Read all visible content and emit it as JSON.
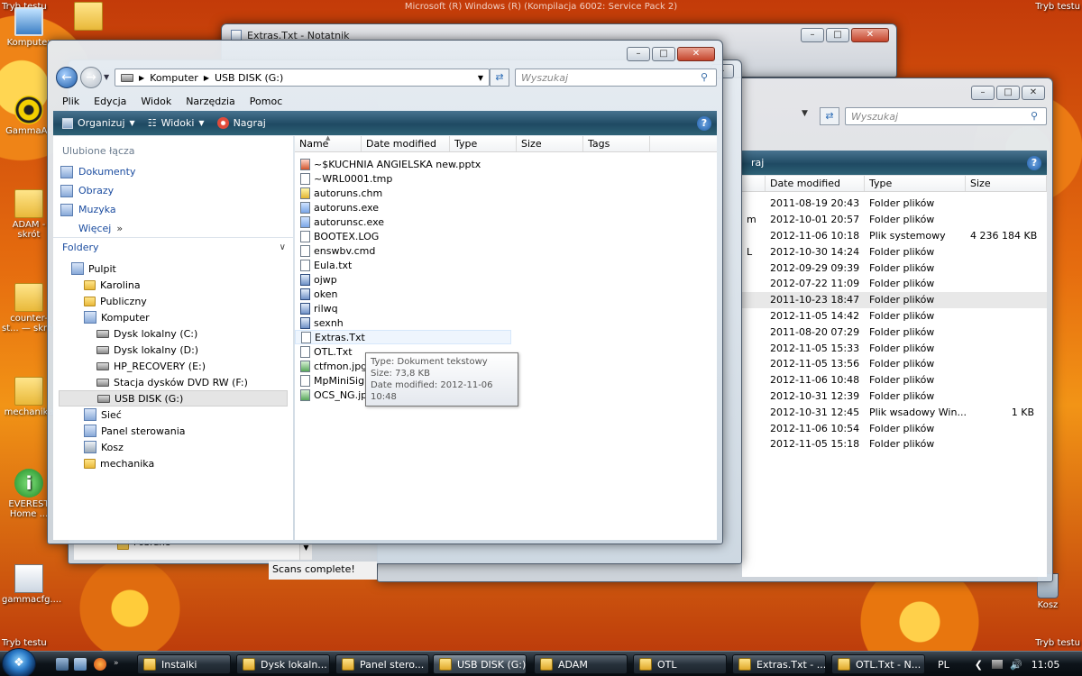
{
  "desktop": {
    "title": "Microsoft (R) Windows (R) (Kompilacja 6002: Service Pack 2)",
    "corner_top_left": "Tryb testu",
    "corner_top_right": "Tryb testu",
    "corner_bottom_left": "Tryb testu",
    "corner_bottom_right": "Tryb testu",
    "icons": {
      "komputer": "Komputer",
      "gamma": "GammaAc",
      "adam": "ADAM - skrót",
      "counter": "counter-st... — skrót",
      "mechanika": "mechanika",
      "everest": "EVEREST Home ...",
      "gammacfg": "gammacfg....",
      "kosz": "Kosz"
    }
  },
  "back_window_notepad": {
    "title": "Extras.Txt - Notatnik"
  },
  "back_window_otl": {
    "status": "Scans complete!",
    "tree_item": "Pobrane"
  },
  "back_window_explorer": {
    "search_placeholder": "Wyszukaj",
    "toolbar_fragment": "raj",
    "columns": {
      "date": "Date modified",
      "type": "Type",
      "size": "Size"
    },
    "rows": [
      {
        "name": "",
        "date": "2011-08-19 20:43",
        "type": "Folder plików",
        "size": ""
      },
      {
        "name": "m",
        "date": "2012-10-01 20:57",
        "type": "Folder plików",
        "size": ""
      },
      {
        "name": "",
        "date": "2012-11-06 10:18",
        "type": "Plik systemowy",
        "size": "4 236 184 KB"
      },
      {
        "name": "L",
        "date": "2012-10-30 14:24",
        "type": "Folder plików",
        "size": ""
      },
      {
        "name": "",
        "date": "2012-09-29 09:39",
        "type": "Folder plików",
        "size": ""
      },
      {
        "name": "",
        "date": "2012-07-22 11:09",
        "type": "Folder plików",
        "size": ""
      },
      {
        "name": "",
        "date": "2011-10-23 18:47",
        "type": "Folder plików",
        "size": ""
      },
      {
        "name": "",
        "date": "2012-11-05 14:42",
        "type": "Folder plików",
        "size": ""
      },
      {
        "name": "",
        "date": "2011-08-20 07:29",
        "type": "Folder plików",
        "size": ""
      },
      {
        "name": "",
        "date": "2012-11-05 15:33",
        "type": "Folder plików",
        "size": ""
      },
      {
        "name": "",
        "date": "2012-11-05 13:56",
        "type": "Folder plików",
        "size": ""
      },
      {
        "name": "",
        "date": "2012-11-06 10:48",
        "type": "Folder plików",
        "size": ""
      },
      {
        "name": "",
        "date": "2012-10-31 12:39",
        "type": "Folder plików",
        "size": ""
      },
      {
        "name": "",
        "date": "2012-10-31 12:45",
        "type": "Plik wsadowy Win...",
        "size": "1 KB"
      },
      {
        "name": "",
        "date": "2012-11-06 10:54",
        "type": "Folder plików",
        "size": ""
      },
      {
        "name": "",
        "date": "2012-11-05 15:18",
        "type": "Folder plików",
        "size": ""
      }
    ]
  },
  "main_window": {
    "breadcrumb": [
      "Komputer",
      "USB DISK (G:)"
    ],
    "search_placeholder": "Wyszukaj",
    "menu": [
      "Plik",
      "Edycja",
      "Widok",
      "Narzędzia",
      "Pomoc"
    ],
    "toolbar": {
      "organize": "Organizuj",
      "views": "Widoki",
      "burn": "Nagraj"
    },
    "favorites_header": "Ulubione łącza",
    "favorites": [
      "Dokumenty",
      "Obrazy",
      "Muzyka"
    ],
    "more": "Więcej",
    "folders_header": "Foldery",
    "tree": [
      {
        "label": "Pulpit",
        "indent": 0,
        "icon": "desktop-icon"
      },
      {
        "label": "Karolina",
        "indent": 1,
        "icon": "user-folder-icon"
      },
      {
        "label": "Publiczny",
        "indent": 1,
        "icon": "folder-icon"
      },
      {
        "label": "Komputer",
        "indent": 1,
        "icon": "computer-icon"
      },
      {
        "label": "Dysk lokalny (C:)",
        "indent": 2,
        "icon": "drive-icon"
      },
      {
        "label": "Dysk lokalny (D:)",
        "indent": 2,
        "icon": "drive-icon"
      },
      {
        "label": "HP_RECOVERY (E:)",
        "indent": 2,
        "icon": "drive-icon"
      },
      {
        "label": "Stacja dysków DVD RW (F:)",
        "indent": 2,
        "icon": "dvd-drive-icon"
      },
      {
        "label": "USB DISK (G:)",
        "indent": 2,
        "icon": "usb-drive-icon"
      },
      {
        "label": "Sieć",
        "indent": 1,
        "icon": "network-icon"
      },
      {
        "label": "Panel sterowania",
        "indent": 1,
        "icon": "control-panel-icon"
      },
      {
        "label": "Kosz",
        "indent": 1,
        "icon": "recycle-bin-icon"
      },
      {
        "label": "mechanika",
        "indent": 1,
        "icon": "folder-icon"
      }
    ],
    "columns": {
      "name": "Name",
      "date": "Date modified",
      "type": "Type",
      "size": "Size",
      "tags": "Tags"
    },
    "files": [
      {
        "name": "~$KUCHNIA ANGIELSKA new.pptx",
        "icon": "ppt"
      },
      {
        "name": "~WRL0001.tmp",
        "icon": "doc"
      },
      {
        "name": "autoruns.chm",
        "icon": "chm"
      },
      {
        "name": "autoruns.exe",
        "icon": "exe"
      },
      {
        "name": "autorunsc.exe",
        "icon": "exe"
      },
      {
        "name": "BOOTEX.LOG",
        "icon": "doc"
      },
      {
        "name": "enswbv.cmd",
        "icon": "doc"
      },
      {
        "name": "Eula.txt",
        "icon": "doc"
      },
      {
        "name": "ojwp",
        "icon": "lnk"
      },
      {
        "name": "oken",
        "icon": "lnk"
      },
      {
        "name": "rilwq",
        "icon": "lnk"
      },
      {
        "name": "sexnh",
        "icon": "lnk"
      },
      {
        "name": "Extras.Txt",
        "icon": "doc"
      },
      {
        "name": "OTL.Txt",
        "icon": "doc"
      },
      {
        "name": "ctfmon.jpg",
        "icon": "jpg"
      },
      {
        "name": "MpMiniSig.S",
        "icon": "doc"
      },
      {
        "name": "OCS_NG.jpg",
        "icon": "jpg"
      }
    ],
    "tooltip": {
      "type": "Type: Dokument tekstowy",
      "size": "Size: 73,8 KB",
      "date": "Date modified: 2012-11-06 10:48"
    }
  },
  "taskbar": {
    "buttons": [
      {
        "label": "Instalki"
      },
      {
        "label": "Dysk lokaln..."
      },
      {
        "label": "Panel stero..."
      },
      {
        "label": "USB DISK (G:)"
      },
      {
        "label": "ADAM"
      },
      {
        "label": "OTL"
      },
      {
        "label": "Extras.Txt - ..."
      },
      {
        "label": "OTL.Txt - N..."
      }
    ],
    "lang": "PL",
    "clock": "11:05"
  }
}
